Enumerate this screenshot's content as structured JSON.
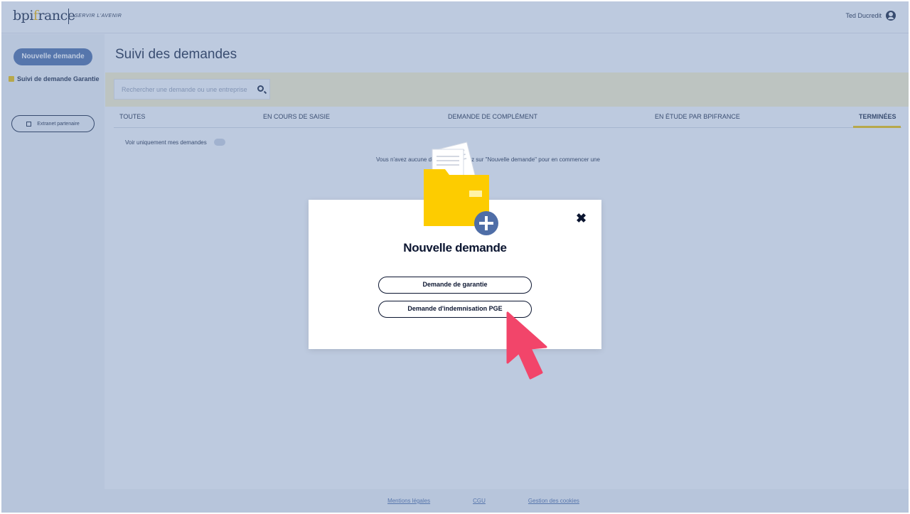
{
  "header": {
    "brand_main": "bpi",
    "brand_dot": "f",
    "brand_rest": "rance",
    "tagline": "SERVIR L'AVENIR",
    "user_name": "Ted Ducredit"
  },
  "sidebar": {
    "new_request": "Nouvelle demande",
    "items": [
      {
        "label": "Suivi de demande Garantie"
      }
    ],
    "extranet": "Extranet partenaire"
  },
  "main": {
    "title": "Suivi des demandes",
    "search_placeholder": "Rechercher une demande ou une entreprise",
    "tabs": [
      {
        "label": "TOUTES"
      },
      {
        "label": "EN COURS DE SAISIE"
      },
      {
        "label": "DEMANDE DE COMPLÉMENT"
      },
      {
        "label": "EN ÉTUDE PAR BPIFRANCE"
      },
      {
        "label": "TERMINÉES"
      }
    ],
    "filter_label": "Voir uniquement mes demandes",
    "empty_message": "Vous n'avez aucune demande. Cliquez sur \"Nouvelle demande\" pour en commencer une"
  },
  "footer": {
    "links": [
      "Mentions légales",
      "CGU",
      "Gestion des cookies"
    ]
  },
  "modal": {
    "title": "Nouvelle demande",
    "close_icon": "close-icon",
    "buttons": [
      {
        "label": "Demande de garantie"
      },
      {
        "label": "Demande d'indemnisation PGE"
      }
    ]
  },
  "colors": {
    "accent": "#f5c400",
    "primary": "#4f6ea7",
    "navy": "#1b2640",
    "cursor": "#f2456a"
  }
}
